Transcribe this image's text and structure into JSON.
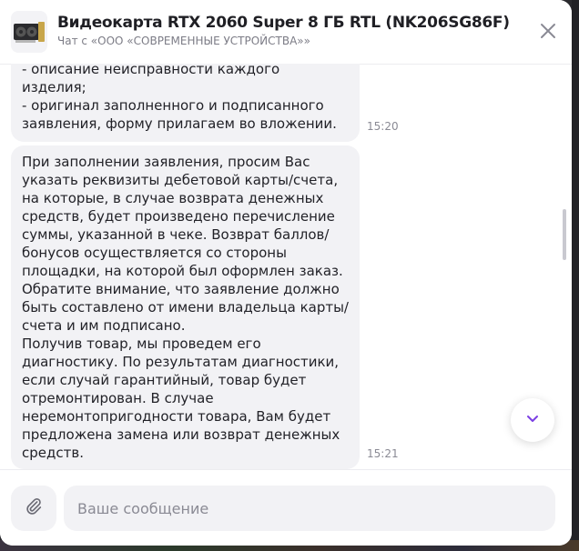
{
  "header": {
    "title": "Видеокарта RTX 2060 Super 8 ГБ RTL (NK206SG86F)",
    "subtitle": "Чат с «ООО «СОВРЕМЕННЫЕ УСТРОЙСТВА»»",
    "product_icon": "gpu-product-thumbnail",
    "close_icon": "close-icon"
  },
  "messages": [
    {
      "text": "- описание неисправности каждого\nизделия;\n- оригинал заполненного и подписанного\nзаявления, форму прилагаем во вложении.",
      "time": "15:20"
    },
    {
      "text": "При заполнении заявления, просим Вас\nуказать реквизиты дебетовой карты/счета,\nна которые, в случае возврата денежных\nсредств, будет произведено перечисление\nсуммы, указанной в чеке. Возврат баллов/\nбонусов осуществляется со стороны\nплощадки, на которой был оформлен заказ.\nОбратите внимание, что заявление должно\nбыть составлено от имени владельца карты/\nсчета и им подписано.\nПолучив товар, мы проведем его\nдиагностику. По результатам диагностики,\nесли случай гарантийный, товар будет\nотремонтирован. В случае\nнеремонтопригодности товара, Вам будет\nпредложена замена или возврат денежных\nсредств.",
      "time": "15:21"
    }
  ],
  "composer": {
    "placeholder": "Ваше сообщение",
    "value": "",
    "attach_icon": "paperclip-icon"
  },
  "scroll_down_icon": "chevron-down-icon",
  "colors": {
    "accent": "#7b3fe4",
    "bubble_bg": "#f2f2f5",
    "text": "#222228",
    "muted": "#8a8a94"
  }
}
